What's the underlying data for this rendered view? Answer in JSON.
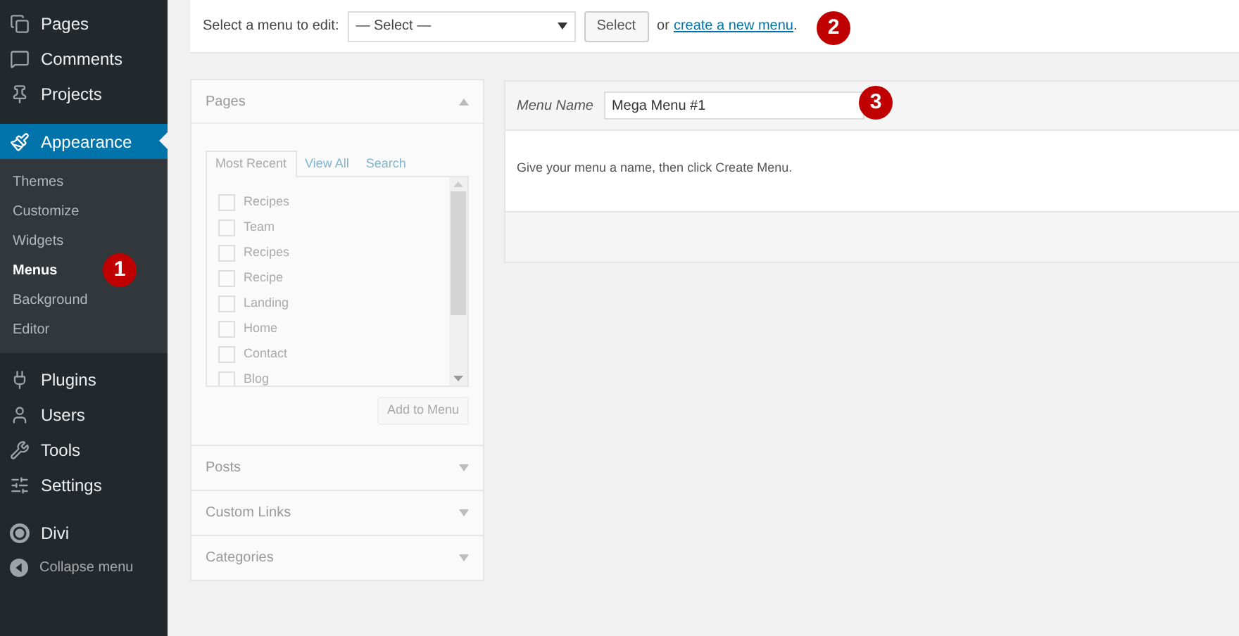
{
  "sidebar": {
    "menu": [
      {
        "label": "Pages",
        "selected": false
      },
      {
        "label": "Comments",
        "selected": false
      },
      {
        "label": "Projects",
        "selected": false
      },
      {
        "label": "Appearance",
        "selected": true,
        "submenu": [
          {
            "label": "Themes",
            "selected": false
          },
          {
            "label": "Customize",
            "selected": false
          },
          {
            "label": "Widgets",
            "selected": false
          },
          {
            "label": "Menus",
            "selected": true
          },
          {
            "label": "Background",
            "selected": false
          },
          {
            "label": "Editor",
            "selected": false
          }
        ]
      },
      {
        "label": "Plugins",
        "selected": false
      },
      {
        "label": "Users",
        "selected": false
      },
      {
        "label": "Tools",
        "selected": false
      },
      {
        "label": "Settings",
        "selected": false
      }
    ],
    "lower_menu": [
      {
        "label": "Divi",
        "selected": false,
        "kind": "item"
      },
      {
        "label": "Collapse menu",
        "selected": false,
        "kind": "collapse"
      }
    ]
  },
  "select_bar": {
    "label": "Select a menu to edit:",
    "dropdown_value": "— Select —",
    "button": "Select",
    "or_text": "or",
    "link": "create a new menu",
    "link_suffix": "."
  },
  "items_panel": {
    "sections": [
      {
        "title": "Pages",
        "expanded": true,
        "tabs": [
          {
            "label": "Most Recent",
            "selected": true
          },
          {
            "label": "View All",
            "selected": false
          },
          {
            "label": "Search",
            "selected": false
          }
        ],
        "items": [
          {
            "label": "Recipes",
            "checked": false
          },
          {
            "label": "Team",
            "checked": false
          },
          {
            "label": "Recipes",
            "checked": false
          },
          {
            "label": "Recipe",
            "checked": false
          },
          {
            "label": "Landing",
            "checked": false
          },
          {
            "label": "Home",
            "checked": false
          },
          {
            "label": "Contact",
            "checked": false
          },
          {
            "label": "Blog",
            "checked": false
          }
        ],
        "button": "Add to Menu"
      },
      {
        "title": "Posts",
        "expanded": false
      },
      {
        "title": "Custom Links",
        "expanded": false
      },
      {
        "title": "Categories",
        "expanded": false
      }
    ]
  },
  "menu_editor": {
    "name_label": "Menu Name",
    "name_value": "Mega Menu #1",
    "instructions": "Give your menu a name, then click Create Menu."
  },
  "annotations": [
    {
      "label": "1"
    },
    {
      "label": "2"
    },
    {
      "label": "3"
    }
  ]
}
